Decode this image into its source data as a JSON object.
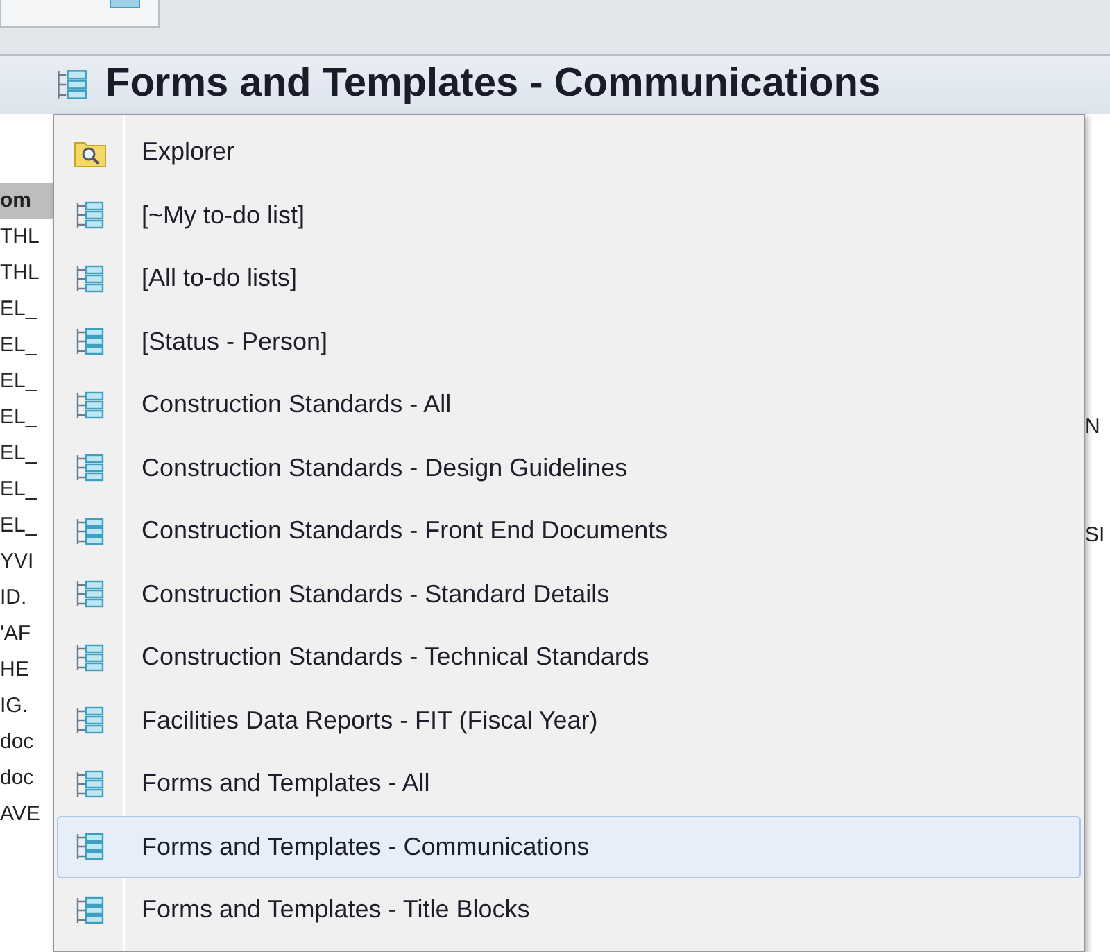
{
  "header": {
    "title": "Forms and Templates - Communications"
  },
  "background_list": {
    "column_header": "om",
    "rows": [
      "THL",
      "THL",
      "EL_",
      "EL_",
      "EL_",
      "EL_",
      "EL_",
      "EL_",
      "EL_",
      "YVI",
      "ID.",
      "'AF",
      "HE",
      "IG.",
      "doc",
      "doc",
      "AVE"
    ]
  },
  "background_right": [
    "N",
    "SI"
  ],
  "menu": {
    "items": [
      {
        "label": "Explorer",
        "kind": "explorer",
        "selected": false
      },
      {
        "label": "[~My to-do list]",
        "kind": "list",
        "selected": false
      },
      {
        "label": "[All to-do lists]",
        "kind": "list",
        "selected": false
      },
      {
        "label": "[Status - Person]",
        "kind": "list",
        "selected": false
      },
      {
        "label": "Construction Standards - All",
        "kind": "list",
        "selected": false
      },
      {
        "label": "Construction Standards - Design Guidelines",
        "kind": "list",
        "selected": false
      },
      {
        "label": "Construction Standards - Front End Documents",
        "kind": "list",
        "selected": false
      },
      {
        "label": "Construction Standards - Standard Details",
        "kind": "list",
        "selected": false
      },
      {
        "label": "Construction Standards - Technical Standards",
        "kind": "list",
        "selected": false
      },
      {
        "label": "Facilities Data Reports - FIT (Fiscal Year)",
        "kind": "list",
        "selected": false
      },
      {
        "label": "Forms and Templates - All",
        "kind": "list",
        "selected": false
      },
      {
        "label": "Forms and Templates - Communications",
        "kind": "list",
        "selected": true
      },
      {
        "label": "Forms and Templates - Title Blocks",
        "kind": "list",
        "selected": false
      }
    ]
  }
}
